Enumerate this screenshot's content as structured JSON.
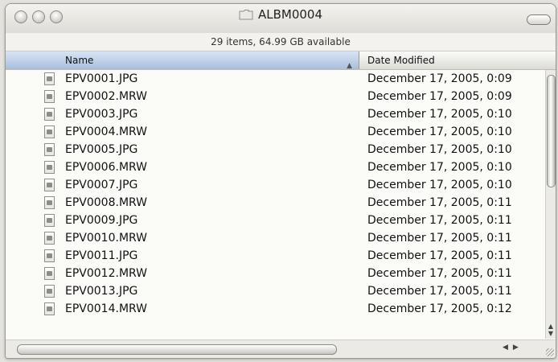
{
  "window": {
    "title": "ALBM0004",
    "status": "29 items, 64.99 GB available"
  },
  "columns": {
    "name": "Name",
    "date": "Date Modified"
  },
  "files": [
    {
      "name": "EPV0001.JPG",
      "date": "December 17, 2005, 0:09"
    },
    {
      "name": "EPV0002.MRW",
      "date": "December 17, 2005, 0:09"
    },
    {
      "name": "EPV0003.JPG",
      "date": "December 17, 2005, 0:10"
    },
    {
      "name": "EPV0004.MRW",
      "date": "December 17, 2005, 0:10"
    },
    {
      "name": "EPV0005.JPG",
      "date": "December 17, 2005, 0:10"
    },
    {
      "name": "EPV0006.MRW",
      "date": "December 17, 2005, 0:10"
    },
    {
      "name": "EPV0007.JPG",
      "date": "December 17, 2005, 0:10"
    },
    {
      "name": "EPV0008.MRW",
      "date": "December 17, 2005, 0:11"
    },
    {
      "name": "EPV0009.JPG",
      "date": "December 17, 2005, 0:11"
    },
    {
      "name": "EPV0010.MRW",
      "date": "December 17, 2005, 0:11"
    },
    {
      "name": "EPV0011.JPG",
      "date": "December 17, 2005, 0:11"
    },
    {
      "name": "EPV0012.MRW",
      "date": "December 17, 2005, 0:11"
    },
    {
      "name": "EPV0013.JPG",
      "date": "December 17, 2005, 0:11"
    },
    {
      "name": "EPV0014.MRW",
      "date": "December 17, 2005, 0:12"
    }
  ],
  "icons": {
    "file": "image-document-icon",
    "folder": "folder-icon"
  }
}
